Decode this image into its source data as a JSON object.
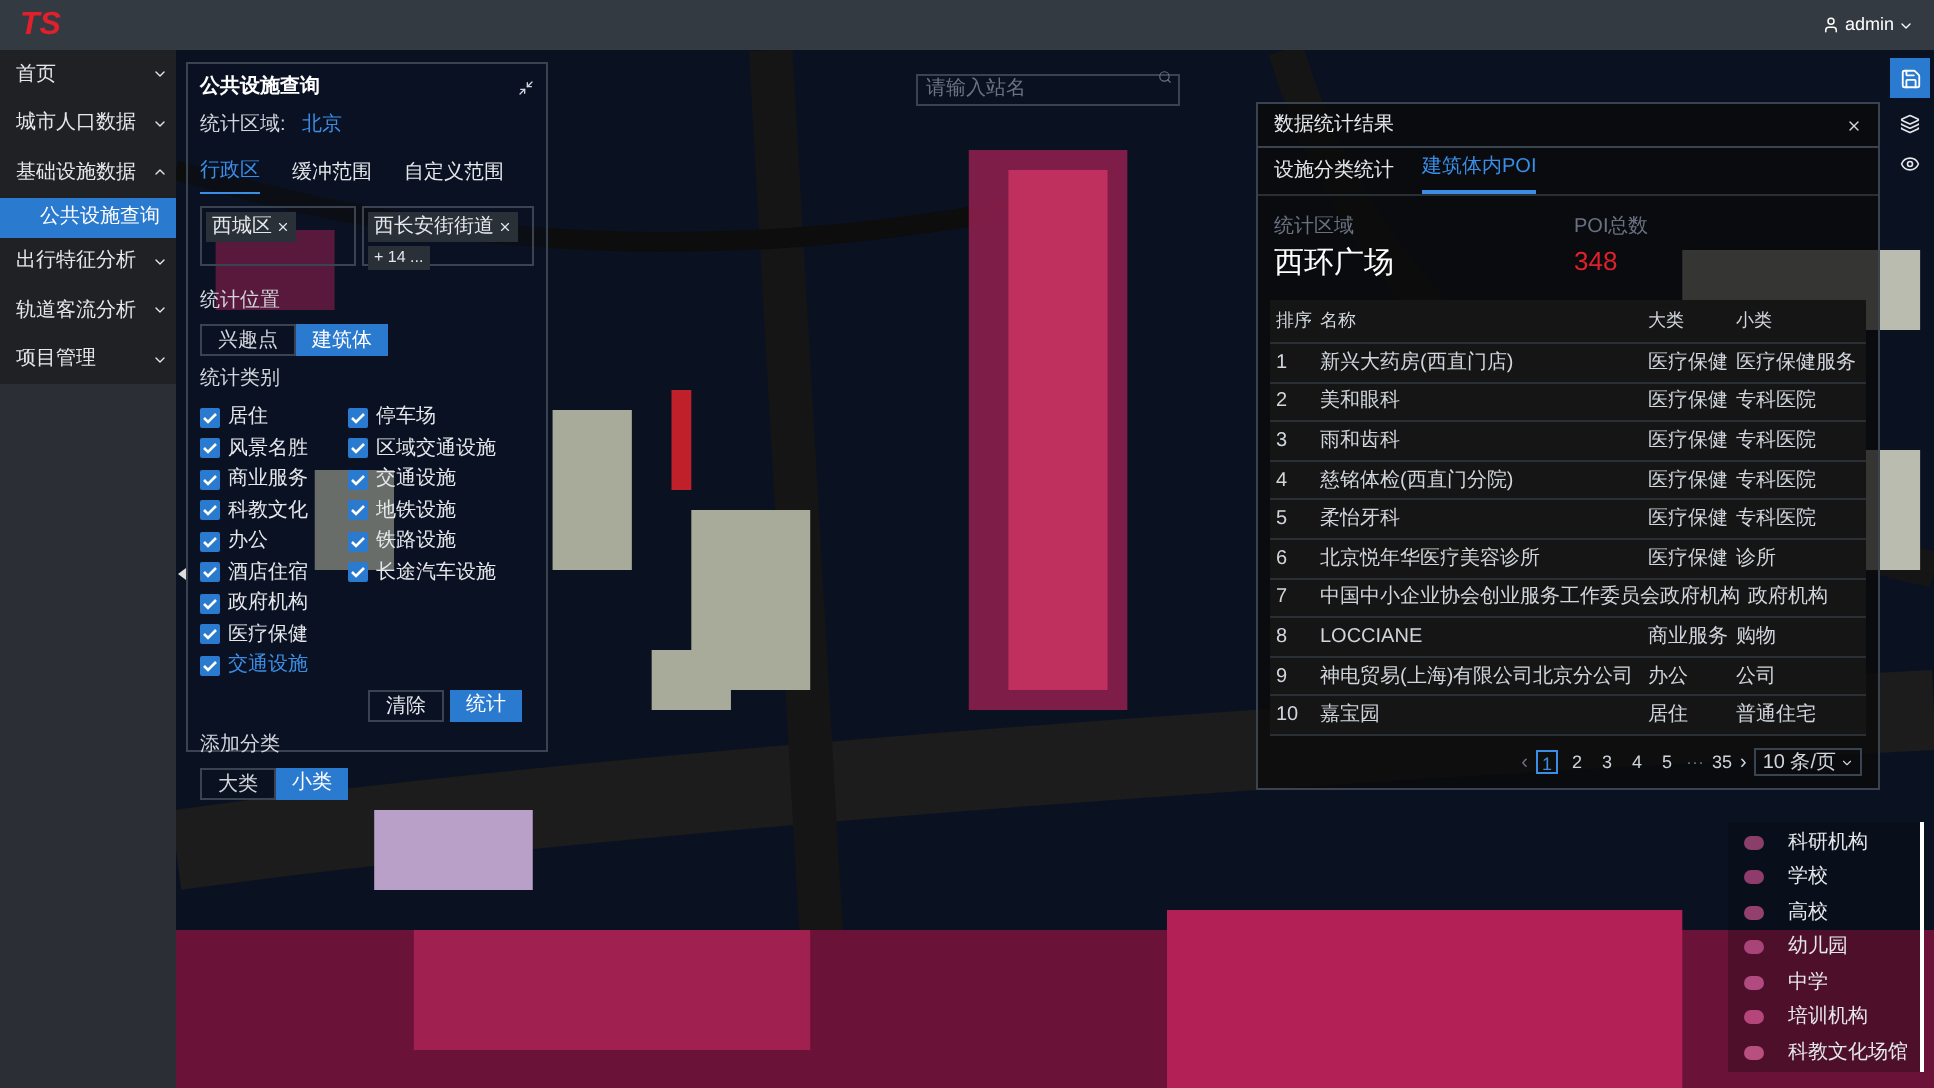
{
  "header": {
    "logo": "TS",
    "user": "admin"
  },
  "sidebar": {
    "items": [
      {
        "label": "首页",
        "expanded": false
      },
      {
        "label": "城市人口数据",
        "expanded": false
      },
      {
        "label": "基础设施数据",
        "expanded": true,
        "children": [
          {
            "label": "公共设施查询",
            "selected": true
          }
        ]
      },
      {
        "label": "出行特征分析",
        "expanded": false
      },
      {
        "label": "轨道客流分析",
        "expanded": false
      },
      {
        "label": "项目管理",
        "expanded": false
      }
    ]
  },
  "search": {
    "placeholder": "请输入站名"
  },
  "query_panel": {
    "title": "公共设施查询",
    "region_label": "统计区域:",
    "region_value": "北京",
    "tabs": [
      {
        "label": "行政区",
        "selected": true
      },
      {
        "label": "缓冲范围",
        "selected": false
      },
      {
        "label": "自定义范围",
        "selected": false
      }
    ],
    "district_tags": [
      "西城区"
    ],
    "street_tags": [
      "西长安街街道"
    ],
    "more_tag": "+ 14 ...",
    "position_label": "统计位置",
    "position_options": [
      {
        "label": "兴趣点",
        "selected": false
      },
      {
        "label": "建筑体",
        "selected": true
      }
    ],
    "category_label": "统计类别",
    "categories_col1": [
      {
        "label": "居住",
        "checked": true,
        "active": false
      },
      {
        "label": "风景名胜",
        "checked": true,
        "active": false
      },
      {
        "label": "商业服务",
        "checked": true,
        "active": false
      },
      {
        "label": "科教文化",
        "checked": true,
        "active": false
      },
      {
        "label": "办公",
        "checked": true,
        "active": false
      },
      {
        "label": "酒店住宿",
        "checked": true,
        "active": false
      },
      {
        "label": "政府机构",
        "checked": true,
        "active": false
      },
      {
        "label": "医疗保健",
        "checked": true,
        "active": false
      },
      {
        "label": "交通设施",
        "checked": true,
        "active": true
      }
    ],
    "categories_col2": [
      {
        "label": "停车场",
        "checked": true,
        "active": false
      },
      {
        "label": "区域交通设施",
        "checked": true,
        "active": false
      },
      {
        "label": "交通设施",
        "checked": true,
        "active": false
      },
      {
        "label": "地铁设施",
        "checked": true,
        "active": false
      },
      {
        "label": "铁路设施",
        "checked": true,
        "active": false
      },
      {
        "label": "长途汽车设施",
        "checked": true,
        "active": false
      }
    ],
    "buttons": [
      {
        "label": "清除",
        "kind": "secondary"
      },
      {
        "label": "统计",
        "kind": "primary"
      }
    ],
    "level_label": "添加分类",
    "level_options": [
      {
        "label": "大类",
        "selected": false
      },
      {
        "label": "小类",
        "selected": true
      }
    ]
  },
  "result_panel": {
    "title": "数据统计结果",
    "tabs": [
      {
        "label": "设施分类统计",
        "selected": false
      },
      {
        "label": "建筑体内POI",
        "selected": true
      }
    ],
    "area_label": "统计区域",
    "area_value": "西环广场",
    "count_label": "POI总数",
    "count_value": "348",
    "table": {
      "columns": [
        "排序",
        "名称",
        "大类",
        "小类"
      ],
      "rows": [
        [
          "1",
          "新兴大药房(西直门店)",
          "医疗保健",
          "医疗保健服务"
        ],
        [
          "2",
          "美和眼科",
          "医疗保健",
          "专科医院"
        ],
        [
          "3",
          "雨和齿科",
          "医疗保健",
          "专科医院"
        ],
        [
          "4",
          "慈铭体检(西直门分院)",
          "医疗保健",
          "专科医院"
        ],
        [
          "5",
          "柔怡牙科",
          "医疗保健",
          "专科医院"
        ],
        [
          "6",
          "北京悦年华医疗美容诊所",
          "医疗保健",
          "诊所"
        ],
        [
          "7",
          "中国中小企业协会创业服务工作委员会",
          "政府机构",
          "政府机构"
        ],
        [
          "8",
          "LOCCIANE",
          "商业服务",
          "购物"
        ],
        [
          "9",
          "神电贸易(上海)有限公司北京分公司",
          "办公",
          "公司"
        ],
        [
          "10",
          "嘉宝园",
          "居住",
          "普通住宅"
        ]
      ]
    },
    "pagination": {
      "prev": "‹",
      "pages": [
        {
          "label": "1",
          "selected": true
        },
        {
          "label": "2",
          "selected": false
        },
        {
          "label": "3",
          "selected": false
        },
        {
          "label": "4",
          "selected": false
        },
        {
          "label": "5",
          "selected": false
        }
      ],
      "ellipsis": "···",
      "last": "35",
      "next": "›",
      "page_size": "10 条/页"
    }
  },
  "legend": [
    {
      "label": "科研机构",
      "color": "#8a3f6a"
    },
    {
      "label": "学校",
      "color": "#8f3c6c"
    },
    {
      "label": "高校",
      "color": "#93406e"
    },
    {
      "label": "幼儿园",
      "color": "#a84478"
    },
    {
      "label": "中学",
      "color": "#b04a80"
    },
    {
      "label": "培训机构",
      "color": "#b5467c"
    },
    {
      "label": "科教文化场馆",
      "color": "#b8507f"
    }
  ]
}
